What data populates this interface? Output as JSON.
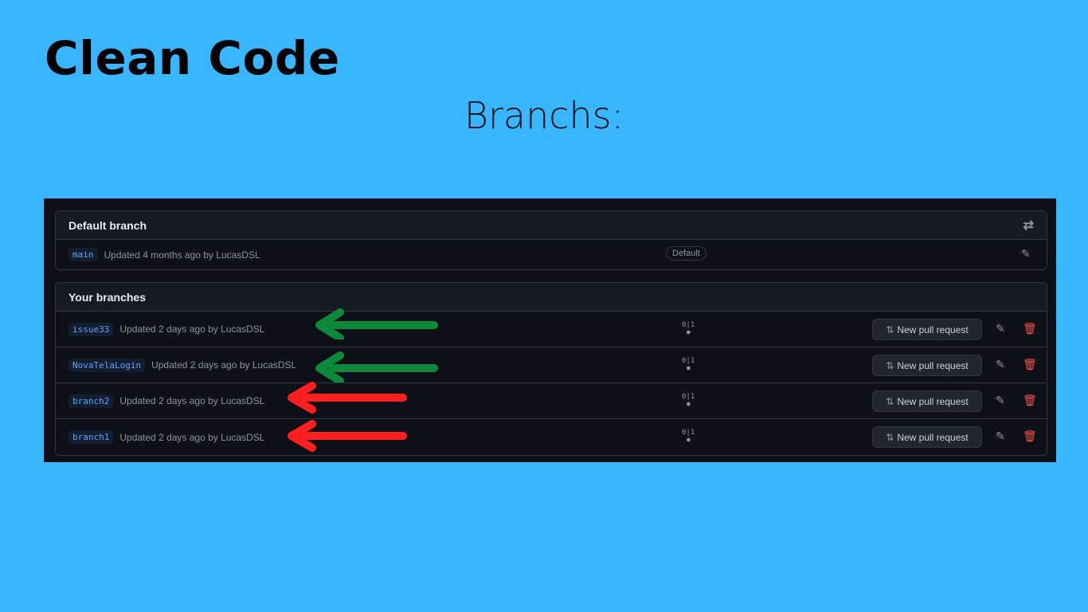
{
  "slide": {
    "title": "Clean Code",
    "subtitle": "Branchs:"
  },
  "default_section": {
    "header": "Default branch",
    "switch_icon": "⇄",
    "branch": {
      "name": "main",
      "meta": "Updated 4 months ago by LucasDSL",
      "badge": "Default",
      "edit_icon": "✎"
    }
  },
  "your_section": {
    "header": "Your branches",
    "pr_label": "New pull request",
    "pr_icon": "⇅",
    "edit_icon": "✎",
    "delete_icon": "🗑",
    "branches": [
      {
        "name": "issue33",
        "meta": "Updated 2 days ago by LucasDSL",
        "behind": "0",
        "ahead": "1",
        "marker_color": "#0a8a3a"
      },
      {
        "name": "NovaTelaLogin",
        "meta": "Updated 2 days ago by LucasDSL",
        "behind": "0",
        "ahead": "1",
        "marker_color": "#0a8a3a"
      },
      {
        "name": "branch2",
        "meta": "Updated 2 days ago by LucasDSL",
        "behind": "0",
        "ahead": "1",
        "marker_color": "#ff1f1f"
      },
      {
        "name": "branch1",
        "meta": "Updated 2 days ago by LucasDSL",
        "behind": "0",
        "ahead": "1",
        "marker_color": "#ff1f1f"
      }
    ]
  },
  "colors": {
    "background": "#38b6ff",
    "panel": "#0d1117",
    "green_arrow": "#0a8a3a",
    "red_arrow": "#ff1f1f"
  }
}
